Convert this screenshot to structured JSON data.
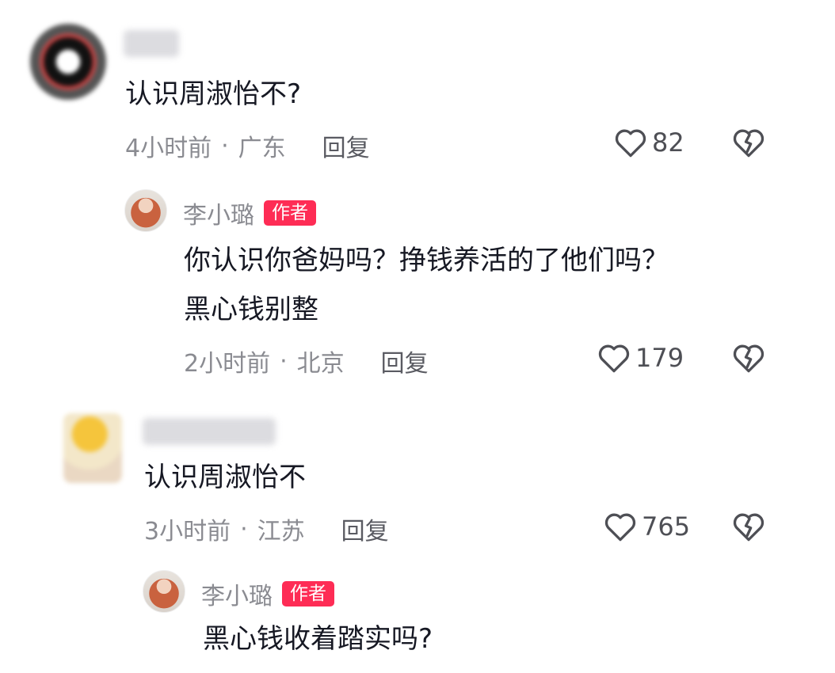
{
  "comments": [
    {
      "text": "认识周淑怡不?",
      "time": "4小时前",
      "sep": "·",
      "location": "广东",
      "reply_label": "回复",
      "likes": "82",
      "reply": {
        "author": "李小璐",
        "badge": "作者",
        "text_line1": "你认识你爸妈吗？挣钱养活的了他们吗？",
        "text_line2": "黑心钱别整",
        "time": "2小时前",
        "sep": "·",
        "location": "北京",
        "reply_label": "回复",
        "likes": "179"
      }
    },
    {
      "text": "认识周淑怡不",
      "time": "3小时前",
      "sep": "·",
      "location": "江苏",
      "reply_label": "回复",
      "likes": "765",
      "reply": {
        "author": "李小璐",
        "badge": "作者",
        "text_line1": "黑心钱收着踏实吗?"
      }
    }
  ],
  "icons": {
    "like": "heart-outline-icon",
    "dislike": "broken-heart-icon"
  },
  "colors": {
    "badge": "#fe2c55",
    "meta": "#8a8b91",
    "text": "#161823"
  }
}
